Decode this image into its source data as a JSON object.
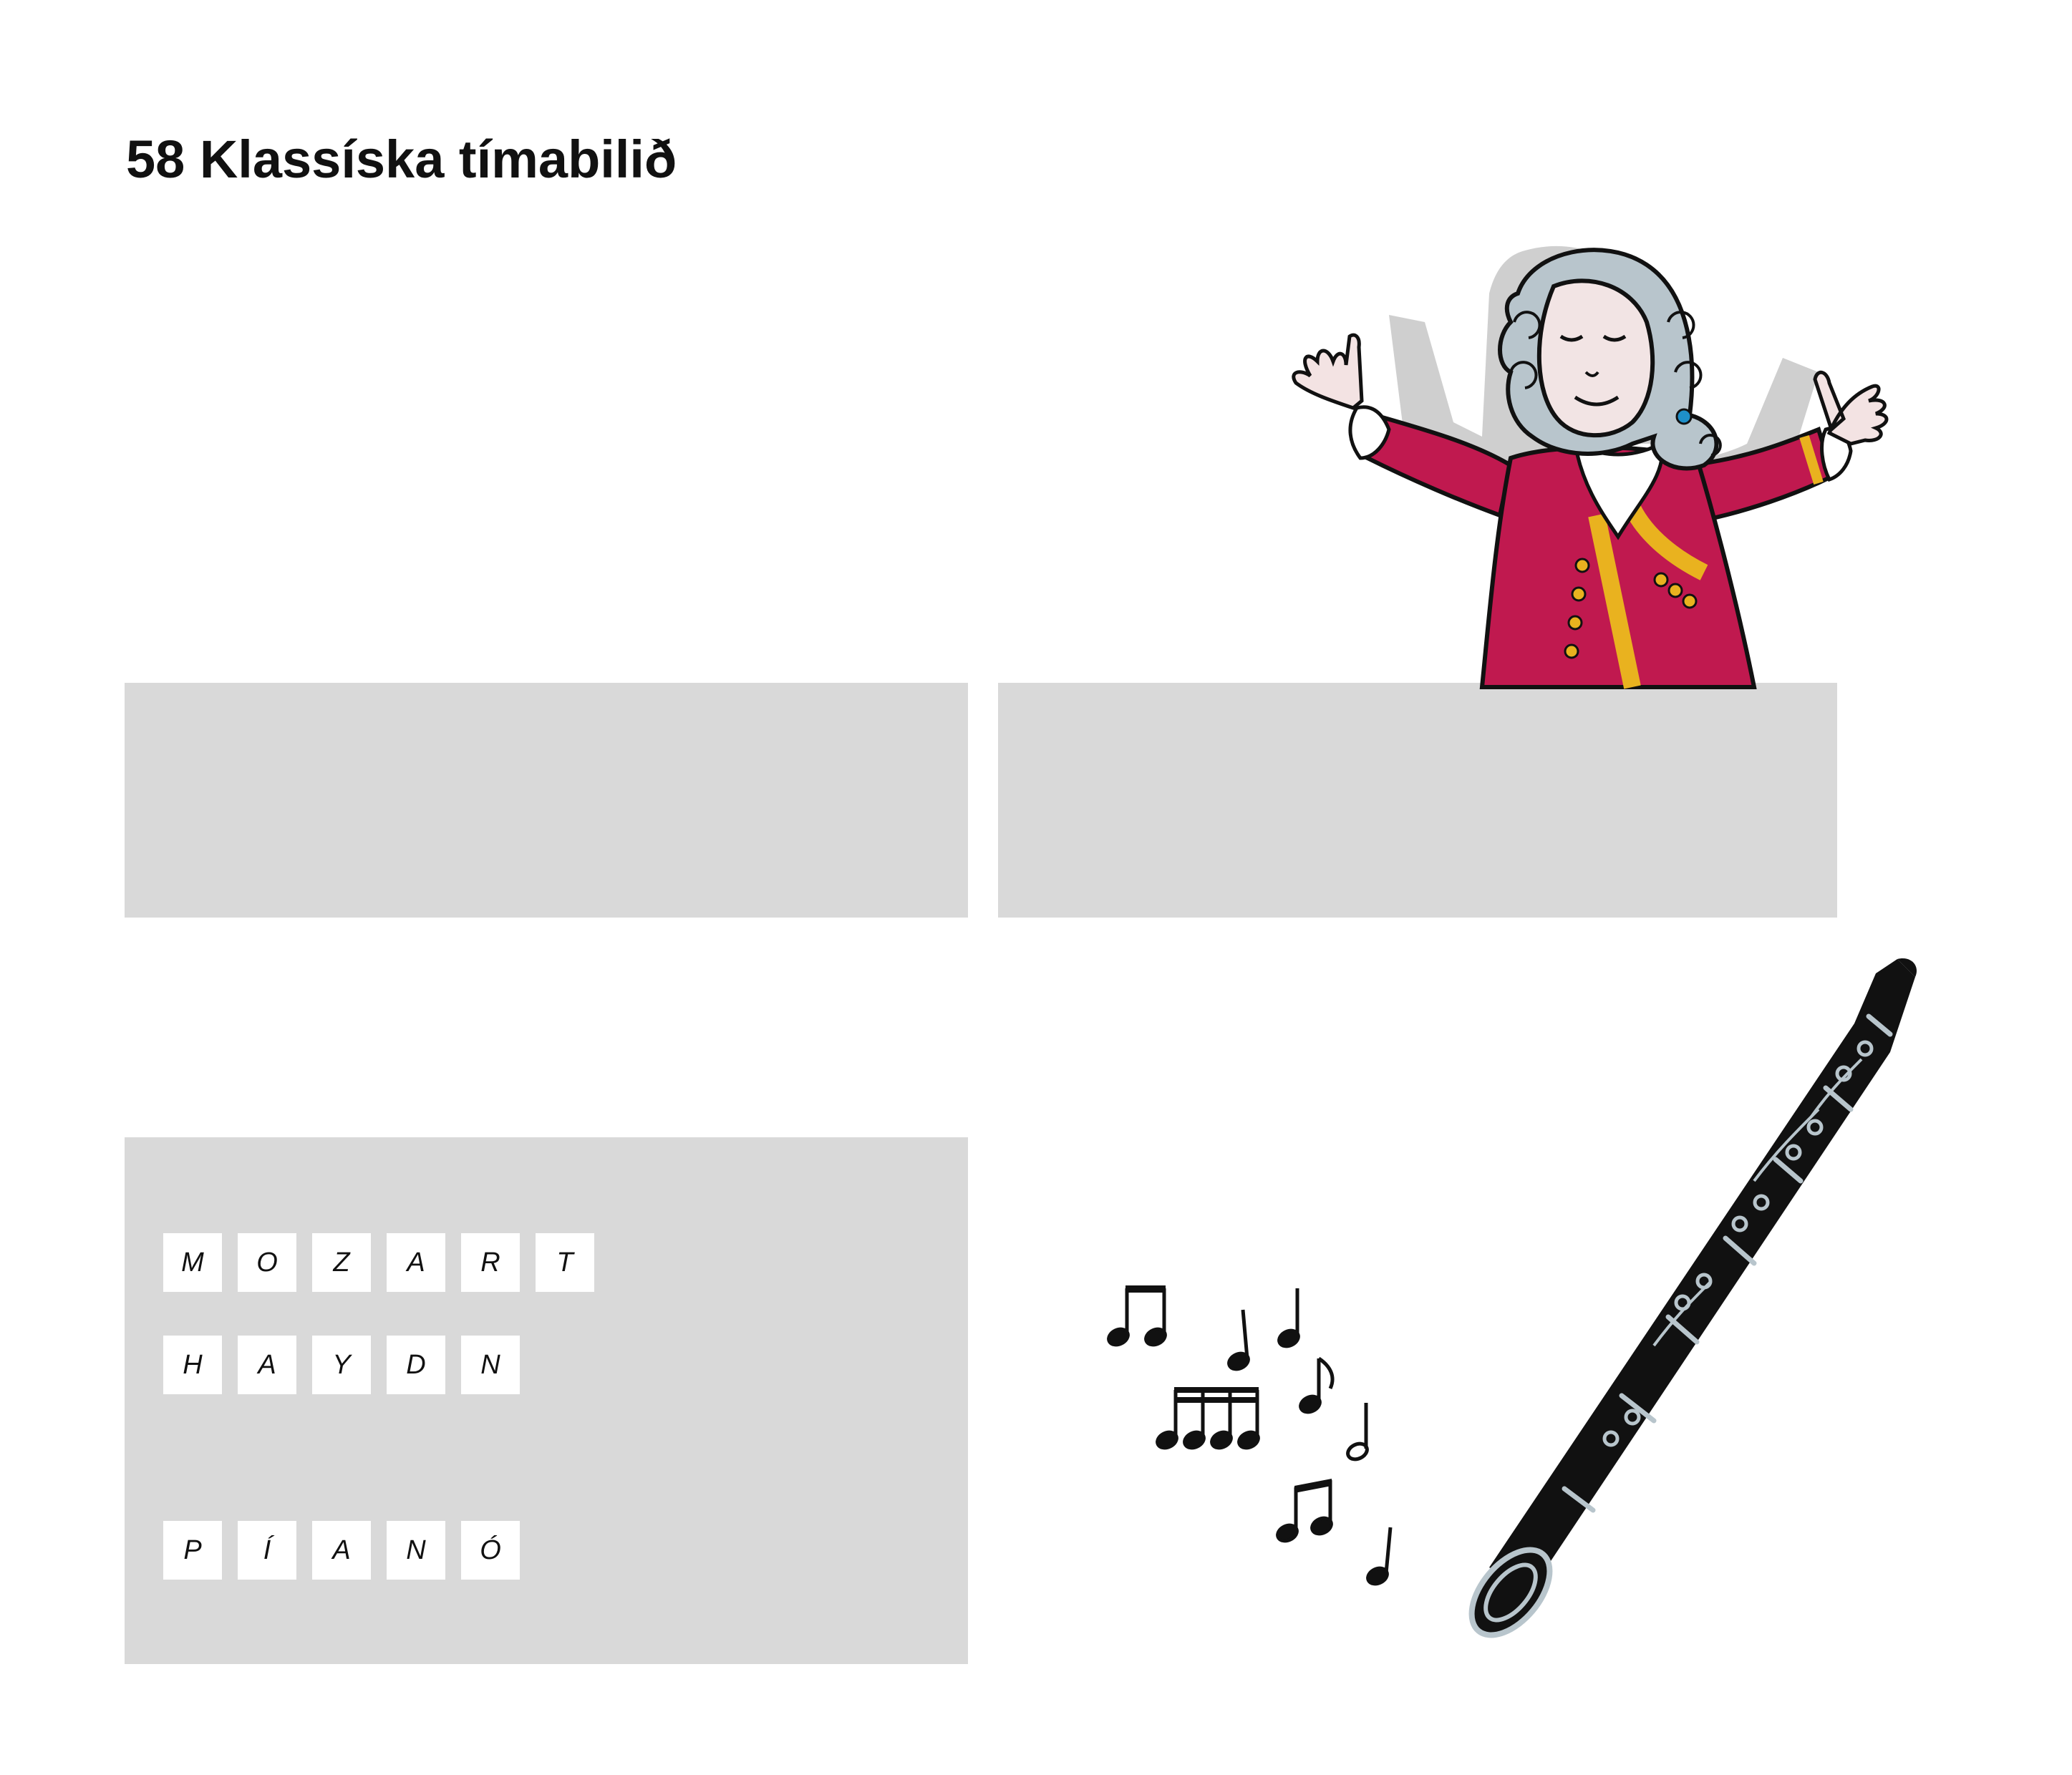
{
  "page": {
    "title": "58 Klassíska tímabilið"
  },
  "word_tiles": {
    "word_1": [
      "M",
      "O",
      "Z",
      "A",
      "R",
      "T"
    ],
    "word_2": [
      "H",
      "A",
      "Y",
      "D",
      "N"
    ],
    "word_3": [
      "P",
      "Í",
      "A",
      "N",
      "Ó"
    ]
  },
  "illustrations": {
    "composer": "composer-illustration",
    "clarinet": "clarinet-illustration",
    "notes": "music-notes-illustration"
  },
  "colors": {
    "panel": "#d9d9d9",
    "coat": "#c0194f",
    "trim": "#e9b21f",
    "wig": "#b8c5cc",
    "clarinet": "#111111"
  }
}
